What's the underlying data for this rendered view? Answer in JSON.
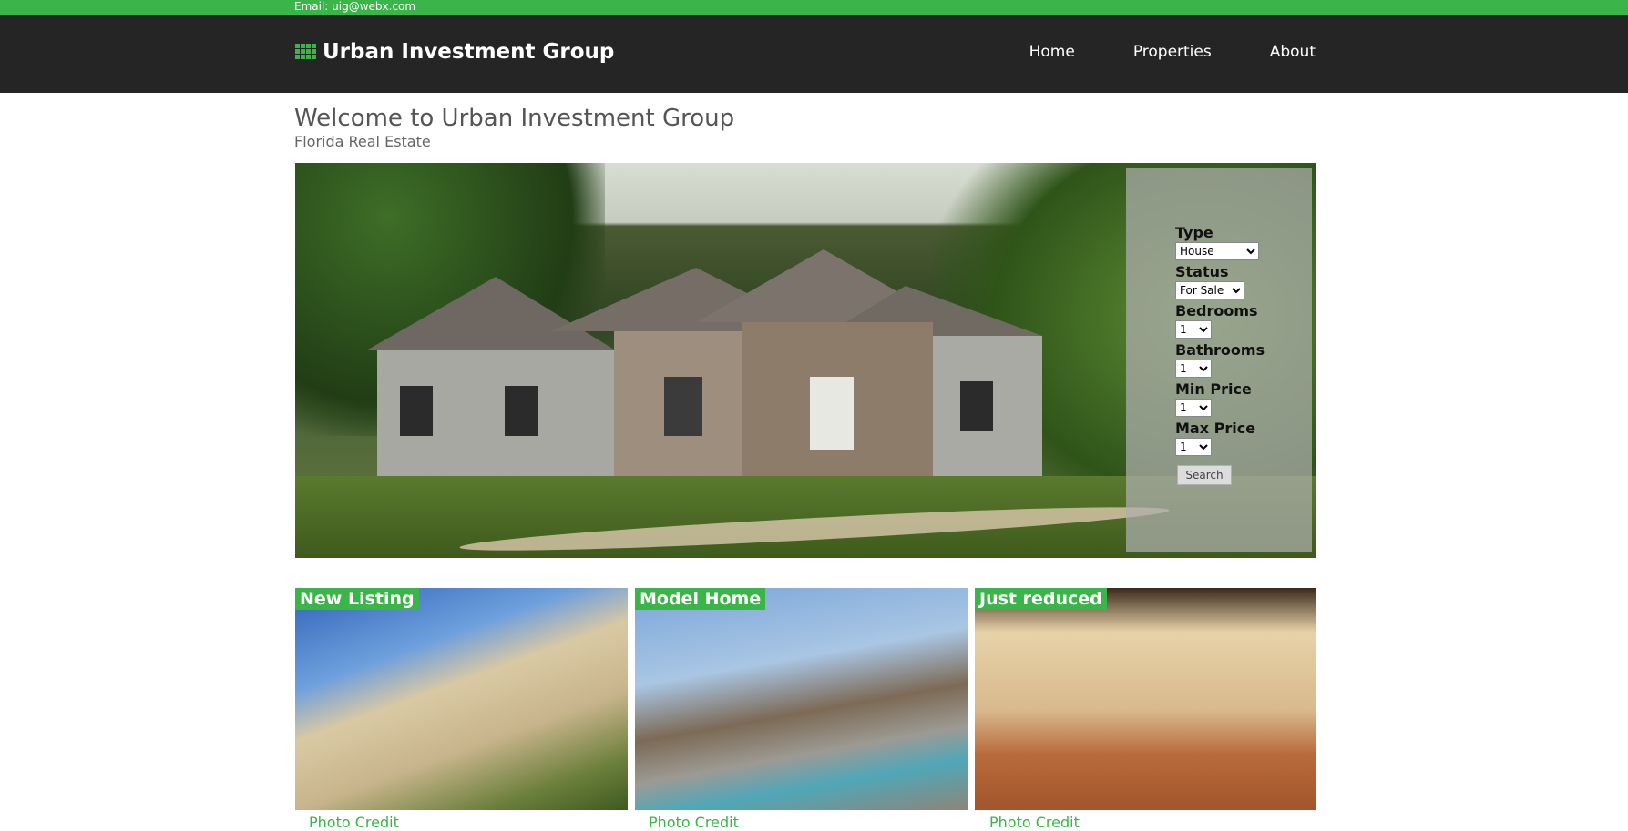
{
  "topbar": {
    "email": "Email: uig@webx.com"
  },
  "brand": {
    "name": "Urban Investment Group"
  },
  "nav": [
    {
      "label": "Home"
    },
    {
      "label": "Properties"
    },
    {
      "label": "About"
    }
  ],
  "welcome": {
    "title": "Welcome to Urban Investment Group",
    "subtitle": "Florida Real Estate"
  },
  "search": {
    "type": {
      "label": "Type",
      "value": "House"
    },
    "status": {
      "label": "Status",
      "value": "For Sale"
    },
    "bedrooms": {
      "label": "Bedrooms",
      "value": "1"
    },
    "bathrooms": {
      "label": "Bathrooms",
      "value": "1"
    },
    "min_price": {
      "label": "Min Price",
      "value": "1"
    },
    "max_price": {
      "label": "Max Price",
      "value": "1"
    },
    "button": "Search"
  },
  "cards": [
    {
      "badge": "New Listing",
      "credit": "Photo Credit"
    },
    {
      "badge": "Model Home",
      "credit": "Photo Credit"
    },
    {
      "badge": "Just reduced",
      "credit": "Photo Credit"
    }
  ],
  "colors": {
    "accent": "#3bb54a",
    "nav_bg": "#252525"
  }
}
